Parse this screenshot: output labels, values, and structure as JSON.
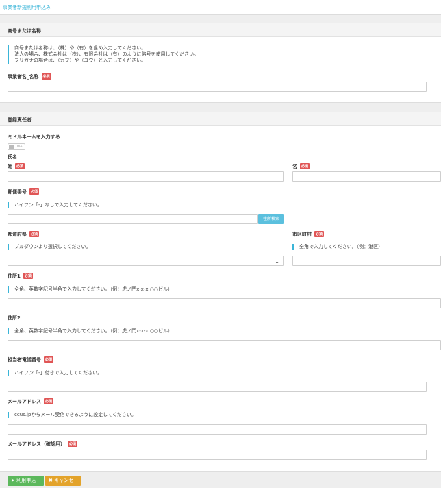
{
  "breadcrumb": "事業者新規利用申込み",
  "section1": {
    "title": "商号または名称",
    "notes": [
      "商号または名称は、（株）や（有）を含め入力してください。",
      "法人の場合、株式会社は（株）、有限会社は（有）のように略号を使用してください。",
      "フリガナの場合は、（カブ）や（ユウ）と入力してください。"
    ],
    "business_name_label": "事業者名_名称",
    "required": "必須"
  },
  "section2": {
    "title": "登録責任者",
    "middle_name_label": "ミドルネームを入力する",
    "toggle_text": "OFF",
    "name_group_label": "氏名",
    "last_name_label": "姓",
    "first_name_label": "名",
    "postal_label": "郵便番号",
    "postal_note": "ハイフン「-」なしで入力してください。",
    "address_search": "住所検索",
    "prefecture_label": "都道府県",
    "prefecture_note": "プルダウンより選択してください。",
    "city_label": "市区町村",
    "city_note": "全角で入力してください。（例：港区）",
    "address1_label": "住所1",
    "address1_note": "全角、英数字記号半角で入力してください。（例：虎ノ門x-x-x ○○ビル）",
    "address2_label": "住所2",
    "address2_note": "全角、英数字記号半角で入力してください。（例：虎ノ門x-x-x ○○ビル）",
    "phone_label": "担当者電話番号",
    "phone_note": "ハイフン「-」付きで入力してください。",
    "email_label": "メールアドレス",
    "email_note": "ccus.jpからメール受信できるように設定してください。",
    "email_confirm_label": "メールアドレス（確認用）"
  },
  "buttons": {
    "submit": "利用申込み",
    "cancel": "キャンセル"
  }
}
